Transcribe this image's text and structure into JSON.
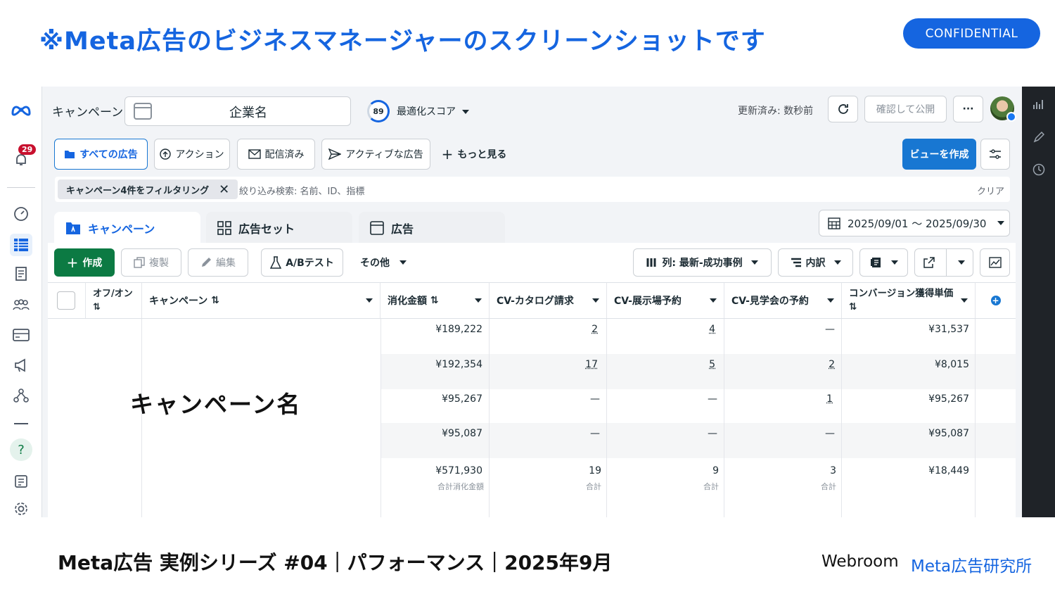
{
  "slide": {
    "title": "※Meta広告のビジネスマネージャーのスクリーンショットです",
    "badge": "CONFIDENTIAL",
    "footer_left": "Meta広告 実例シリーズ #04｜パフォーマンス｜2025年9月",
    "footer_brand": "Webroom",
    "footer_lab": "Meta広告研究所"
  },
  "colors": {
    "accent": "#1565e0",
    "primary_button": "#1877d2",
    "create_button": "#0c7a43"
  },
  "nav": {
    "notification_count": "29",
    "icons": [
      "meta-logo-icon",
      "bell-icon",
      "gauge-icon",
      "table-icon",
      "pages-icon",
      "audience-icon",
      "billing-icon",
      "megaphone-icon",
      "network-icon",
      "help-icon",
      "news-icon",
      "gear-icon"
    ]
  },
  "header": {
    "title": "キャンペーン",
    "campaign_name": "企業名",
    "score": "89",
    "score_label": "最適化スコア",
    "updated": "更新済み: 数秒前",
    "publish": "確認して公開",
    "more": "···"
  },
  "views": {
    "all_ads": "すべての広告",
    "action": "アクション",
    "delivered": "配信済み",
    "active_ads": "アクティブな広告",
    "more": "もっと見る",
    "create_view": "ビューを作成"
  },
  "filter": {
    "chip": "キャンペーン4件をフィルタリング",
    "search_placeholder": "絞り込み検索: 名前、ID、指標",
    "clear": "クリア"
  },
  "tabs": {
    "campaign": "キャンペーン",
    "adset": "広告セット",
    "ad": "広告"
  },
  "date_range": "2025/09/01 〜 2025/09/30",
  "toolbar": {
    "create": "作成",
    "duplicate": "複製",
    "edit": "編集",
    "ab_test": "A/Bテスト",
    "other": "その他",
    "columns": "列: 最新-成功事例",
    "breakdown": "内訳"
  },
  "table": {
    "headers": {
      "onoff": "オフ/オン",
      "campaign": "キャンペーン",
      "spend": "消化金額",
      "cv_catalog": "CV-カタログ請求",
      "cv_showroom": "CV-展示場予約",
      "cv_tour": "CV-見学会の予約",
      "cpa": "コンバージョン獲得単価"
    },
    "sort_icon": "⇅",
    "rows": [
      {
        "spend": "¥189,222",
        "catalog": "2",
        "showroom": "4",
        "tour": "—",
        "cpa": "¥31,537"
      },
      {
        "spend": "¥192,354",
        "catalog": "17",
        "showroom": "5",
        "tour": "2",
        "cpa": "¥8,015"
      },
      {
        "spend": "¥95,267",
        "catalog": "—",
        "showroom": "—",
        "tour": "1",
        "cpa": "¥95,267"
      },
      {
        "spend": "¥95,087",
        "catalog": "—",
        "showroom": "—",
        "tour": "—",
        "cpa": "¥95,087"
      }
    ],
    "totals": {
      "spend": "¥571,930",
      "spend_label": "合計消化金額",
      "catalog": "19",
      "showroom": "9",
      "tour": "3",
      "total_label": "合計",
      "cpa": "¥18,449"
    },
    "overlay_name": "キャンペーン名"
  }
}
